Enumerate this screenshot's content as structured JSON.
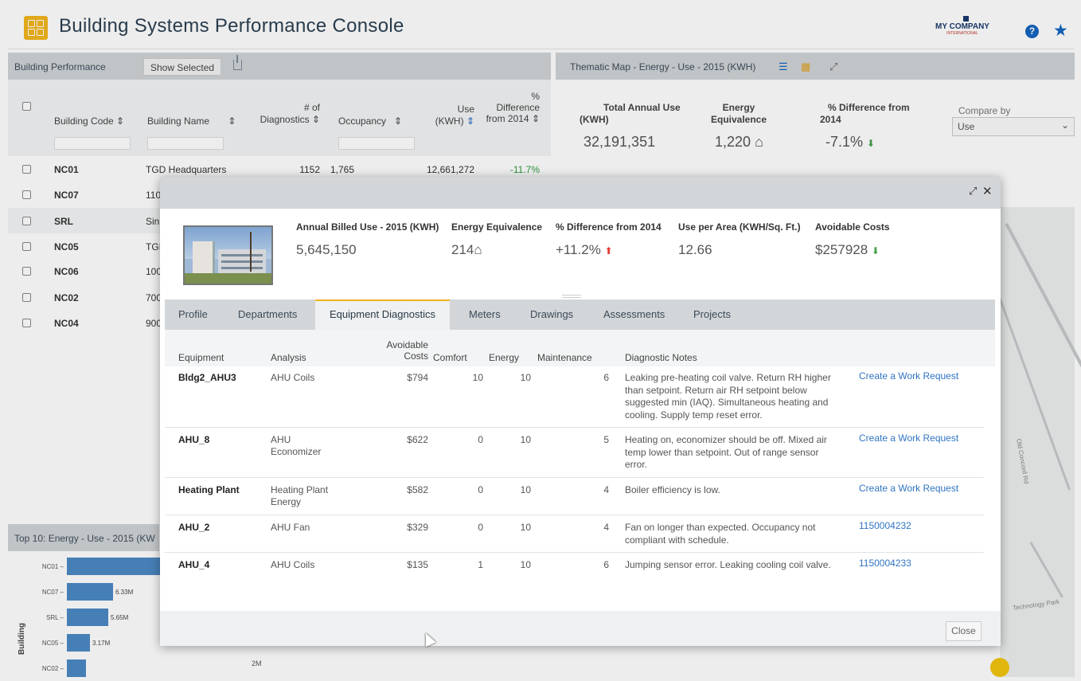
{
  "app": {
    "title": "Building Systems Performance Console",
    "company": "MY COMPANY",
    "company_sub": "INTERNATIONAL"
  },
  "building_performance": {
    "title": "Building Performance",
    "show_selected": "Show Selected",
    "columns": {
      "code": "Building Code",
      "name": "Building Name",
      "diag_1": "# of",
      "diag_2": "Diagnostics",
      "occupancy": "Occupancy",
      "use_1": "Use",
      "use_2": "(KWH)",
      "diff_1": "%",
      "diff_2": "Difference",
      "diff_3": "from 2014"
    },
    "rows": [
      {
        "code": "NC01",
        "name": "TGD Headquarters",
        "diagnostics": "1152",
        "occupancy": "1,765",
        "use": "12,661,272",
        "diff": "-11.7%"
      },
      {
        "code": "NC07",
        "name": "110"
      },
      {
        "code": "SRL",
        "name": "Sin"
      },
      {
        "code": "NC05",
        "name": "TGI"
      },
      {
        "code": "NC06",
        "name": "100"
      },
      {
        "code": "NC02",
        "name": "700"
      },
      {
        "code": "NC04",
        "name": "900"
      }
    ]
  },
  "thematic_map": {
    "title": "Thematic Map - Energy - Use - 2015 (KWH)",
    "kpis": [
      {
        "label_1": "Total Annual Use",
        "label_2": "(KWH)",
        "value": "32,191,351"
      },
      {
        "label_1": "Energy",
        "label_2": "Equivalence",
        "value": "1,220"
      },
      {
        "label_1": "% Difference from",
        "label_2": "2014",
        "value": "-7.1%"
      }
    ],
    "compare_by_label": "Compare by",
    "compare_by_value": "Use",
    "map_labels": [
      "Old Concord Rd",
      "Technology Park"
    ]
  },
  "top10": {
    "title": "Top 10: Energy - Use - 2015 (KW",
    "axis_label": "Building",
    "bars": [
      {
        "label": "NC01",
        "value_text": "",
        "fraction": 1.0
      },
      {
        "label": "NC07",
        "value_text": "6.33M",
        "fraction": 0.48
      },
      {
        "label": "SRL",
        "value_text": "5.65M",
        "fraction": 0.43
      },
      {
        "label": "NC05",
        "value_text": "3.17M",
        "fraction": 0.24
      },
      {
        "label": "NC02",
        "value_text": "",
        "fraction": 0.2
      }
    ],
    "below_tick": "2M"
  },
  "modal": {
    "kpis": [
      {
        "label": "Annual Billed Use - 2015 (KWH)",
        "value": "5,645,150"
      },
      {
        "label": "Energy Equivalence",
        "value": "214"
      },
      {
        "label": "% Difference from 2014",
        "value": "+11.2%"
      },
      {
        "label": "Use per Area (KWH/Sq. Ft.)",
        "value": "12.66"
      },
      {
        "label": "Avoidable Costs",
        "value": "$257928"
      }
    ],
    "tabs": [
      "Profile",
      "Departments",
      "Equipment Diagnostics",
      "Meters",
      "Drawings",
      "Assessments",
      "Projects"
    ],
    "columns": {
      "equipment": "Equipment",
      "analysis": "Analysis",
      "avoidable_1": "Avoidable",
      "avoidable_2": "Costs",
      "comfort": "Comfort",
      "energy": "Energy",
      "maintenance": "Maintenance",
      "notes": "Diagnostic Notes"
    },
    "rows": [
      {
        "equipment": "Bldg2_AHU3",
        "analysis": "AHU Coils",
        "cost": "$794",
        "comfort": "10",
        "energy": "10",
        "maintenance": "6",
        "notes": "Leaking pre-heating coil valve. Return RH higher than setpoint. Return air RH setpoint below suggested min (IAQ). Simultaneous heating and cooling. Supply temp reset error.",
        "action": "Create a Work Request"
      },
      {
        "equipment": "AHU_8",
        "analysis": "AHU Economizer",
        "cost": "$622",
        "comfort": "0",
        "energy": "10",
        "maintenance": "5",
        "notes": "Heating on, economizer should be off. Mixed air temp lower than setpoint. Out of range sensor error.",
        "action": "Create a Work Request"
      },
      {
        "equipment": "Heating Plant",
        "analysis": "Heating Plant Energy",
        "cost": "$582",
        "comfort": "0",
        "energy": "10",
        "maintenance": "4",
        "notes": "Boiler efficiency is low.",
        "action": "Create a Work Request"
      },
      {
        "equipment": "AHU_2",
        "analysis": "AHU Fan",
        "cost": "$329",
        "comfort": "0",
        "energy": "10",
        "maintenance": "4",
        "notes": "Fan on longer than expected. Occupancy not compliant with schedule.",
        "action": "1150004232"
      },
      {
        "equipment": "AHU_4",
        "analysis": "AHU Coils",
        "cost": "$135",
        "comfort": "1",
        "energy": "10",
        "maintenance": "6",
        "notes": "Jumping sensor error. Leaking cooling coil valve.",
        "action": "1150004233"
      }
    ],
    "close_label": "Close"
  },
  "colors": {
    "accent": "#f2b51c",
    "link": "#2f74c4",
    "positive": "#43a047",
    "negative": "#e53935",
    "bar": "#4c89c4"
  }
}
